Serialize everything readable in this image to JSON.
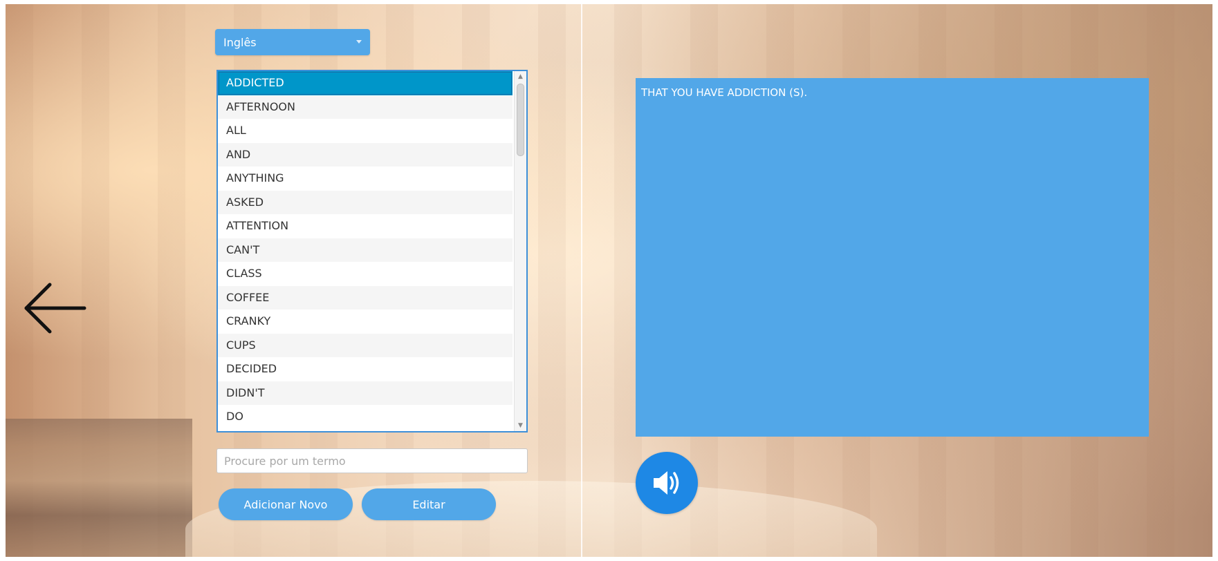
{
  "language_select": {
    "selected": "Inglês"
  },
  "word_list": {
    "selected_index": 0,
    "items": [
      "ADDICTED",
      "AFTERNOON",
      "ALL",
      "AND",
      "ANYTHING",
      "ASKED",
      "ATTENTION",
      "CAN'T",
      "CLASS",
      "COFFEE",
      "CRANKY",
      "CUPS",
      "DECIDED",
      "DIDN'T",
      "DO"
    ]
  },
  "search": {
    "placeholder": "Procure por um termo",
    "value": ""
  },
  "buttons": {
    "add_label": "Adicionar Novo",
    "edit_label": "Editar"
  },
  "definition": {
    "text": "THAT YOU HAVE ADDICTION (S)."
  },
  "icons": {
    "back": "arrow-left-icon",
    "sound": "speaker-icon",
    "dropdown": "caret-down-icon"
  },
  "colors": {
    "accent": "#52a7e8",
    "selected_row": "#0096c9",
    "sound_button": "#1e88e5"
  }
}
